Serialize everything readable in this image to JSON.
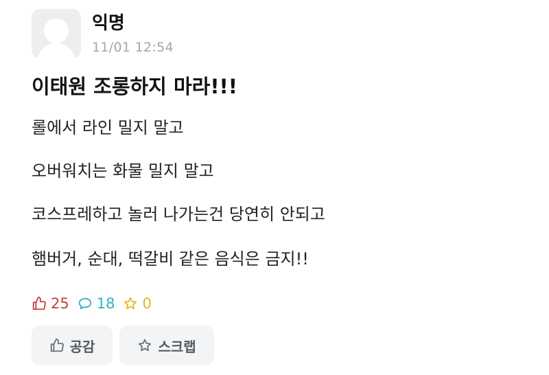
{
  "author": {
    "name": "익명",
    "time": "11/01 12:54"
  },
  "post": {
    "title": "이태원 조롱하지 마라!!!",
    "lines": [
      "롤에서 라인 밀지 말고",
      "오버워치는 화물 밀지 말고",
      "코스프레하고 놀러 나가는건 당연히 안되고",
      "햄버거, 순대, 떡갈비 같은 음식은 금지!!"
    ]
  },
  "stats": {
    "likes": "25",
    "comments": "18",
    "scraps": "0"
  },
  "actions": {
    "like_label": "공감",
    "scrap_label": "스크랩"
  },
  "icons": {
    "like": "thumbs-up-icon",
    "comment": "speech-bubble-icon",
    "scrap": "star-icon",
    "avatar": "default-user-avatar"
  },
  "colors": {
    "like": "#c2403a",
    "comment": "#2fb2c7",
    "scrap": "#e3b71c",
    "meta_gray": "#a2a6ab",
    "button_bg": "#f3f4f5"
  }
}
